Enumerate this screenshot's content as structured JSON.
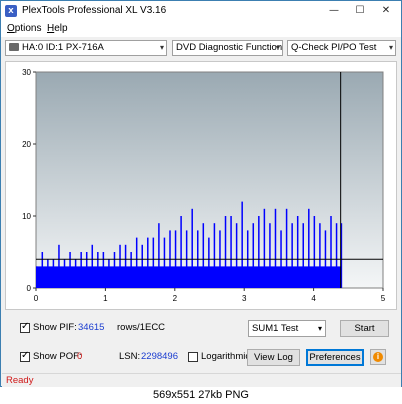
{
  "window": {
    "title": "PlexTools Professional XL V3.16",
    "icon_name": "plextools-app-icon"
  },
  "menu": {
    "items": [
      "Options",
      "Help"
    ]
  },
  "toolbar": {
    "drive": "HA:0 ID:1  PX-716A",
    "function": "DVD Diagnostic Functions",
    "test": "Q-Check PI/PO Test"
  },
  "controls": {
    "show_pif_label": "Show PIF:",
    "pif_value": "34615",
    "pif_unit": "rows/1ECC",
    "show_pof_label": "Show POF:",
    "pof_value": "0",
    "lsn_label": "LSN:",
    "lsn_value": "2298496",
    "logarithmic_label": "Logarithmic",
    "sum_select": "SUM1 Test",
    "start_label": "Start",
    "view_log_label": "View Log",
    "preferences_label": "Preferences",
    "show_pif_checked": true,
    "show_pof_checked": true,
    "logarithmic_checked": false
  },
  "status": {
    "text": "Ready"
  },
  "caption": {
    "text": "569x551  27kb  PNG"
  },
  "colors": {
    "plot_bg_top": "#9aa9b2",
    "plot_bg_bottom": "#f4f6f7",
    "bar_color": "#0000ff",
    "threshold_color": "#000000",
    "status_color": "#d01a1a",
    "value_blue": "#1a3cd0"
  },
  "chart_data": {
    "type": "bar",
    "title": "",
    "xlabel": "",
    "ylabel": "",
    "xlim": [
      0,
      5
    ],
    "ylim": [
      0,
      30
    ],
    "x_ticks": [
      "0",
      "1",
      "2",
      "3",
      "4",
      "5"
    ],
    "y_ticks": [
      "0",
      "10",
      "20",
      "30"
    ],
    "threshold": 4,
    "scan_end": 4.39,
    "series": [
      {
        "x": [
          0.0,
          0.08,
          0.16,
          0.24,
          0.32,
          0.4,
          0.48,
          0.56,
          0.64,
          0.72,
          0.8,
          0.88,
          0.96,
          1.04,
          1.12,
          1.2,
          1.28,
          1.36,
          1.44,
          1.52,
          1.6,
          1.68,
          1.76,
          1.84,
          1.92,
          2.0,
          2.08,
          2.16,
          2.24,
          2.32,
          2.4,
          2.48,
          2.56,
          2.64,
          2.72,
          2.8,
          2.88,
          2.96,
          3.04,
          3.12,
          3.2,
          3.28,
          3.36,
          3.44,
          3.52,
          3.6,
          3.68,
          3.76,
          3.84,
          3.92,
          4.0,
          4.08,
          4.16,
          4.24,
          4.32,
          4.39
        ],
        "values": [
          3,
          5,
          4,
          4,
          6,
          4,
          5,
          4,
          5,
          5,
          6,
          5,
          5,
          4,
          5,
          6,
          6,
          5,
          7,
          6,
          7,
          7,
          9,
          7,
          8,
          8,
          10,
          8,
          11,
          8,
          9,
          7,
          9,
          8,
          10,
          10,
          9,
          12,
          8,
          9,
          10,
          11,
          9,
          11,
          8,
          11,
          9,
          10,
          9,
          11,
          10,
          9,
          8,
          10,
          9,
          9
        ]
      }
    ]
  }
}
